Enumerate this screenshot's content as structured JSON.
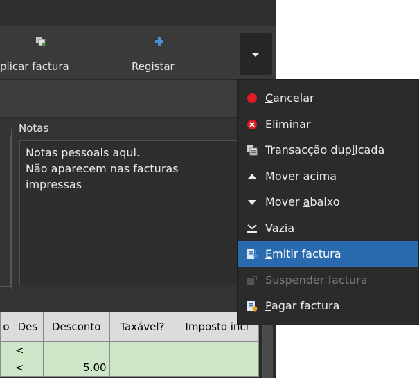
{
  "toolbar": {
    "duplicate_label": "plicar factura",
    "register_label": "Registar",
    "more_icon": "chevron-down-icon"
  },
  "notes": {
    "legend": "Notas",
    "text": "Notas pessoais aqui.\nNão aparecem nas facturas\nimpressas"
  },
  "table": {
    "columns": [
      "o",
      "Des",
      "Desconto",
      "Taxável?",
      "Imposto incl"
    ],
    "rows": [
      [
        "",
        "<",
        "",
        "",
        ""
      ],
      [
        "",
        "<",
        "5.00",
        "",
        ""
      ]
    ]
  },
  "menu": {
    "items": [
      {
        "icon": "cancel-icon",
        "pre": "",
        "key": "C",
        "post": "ancelar",
        "state": "normal"
      },
      {
        "icon": "delete-icon",
        "pre": "",
        "key": "E",
        "post": "liminar",
        "state": "normal"
      },
      {
        "icon": "duplicate-icon",
        "pre": "Transacção dup",
        "key": "l",
        "post": "icada",
        "state": "normal"
      },
      {
        "icon": "arrow-up-icon",
        "pre": "",
        "key": "M",
        "post": "over acima",
        "state": "normal"
      },
      {
        "icon": "arrow-down-icon",
        "pre": "Mover ",
        "key": "a",
        "post": "baixo",
        "state": "normal"
      },
      {
        "icon": "clear-icon",
        "pre": "",
        "key": "V",
        "post": "azia",
        "state": "normal"
      },
      {
        "icon": "post-invoice-icon",
        "pre": "",
        "key": "E",
        "post": "mitir factura",
        "state": "highlighted"
      },
      {
        "icon": "unpost-invoice-icon",
        "pre": "Suspender factura",
        "key": "",
        "post": "",
        "state": "disabled"
      },
      {
        "icon": "pay-invoice-icon",
        "pre": "",
        "key": "P",
        "post": "agar factura",
        "state": "normal"
      }
    ]
  },
  "colors": {
    "highlight": "#2a6bb0",
    "cancel_red": "#e01b24",
    "row_green": "#cfe7c9",
    "header_grey": "#dcdcdc"
  }
}
